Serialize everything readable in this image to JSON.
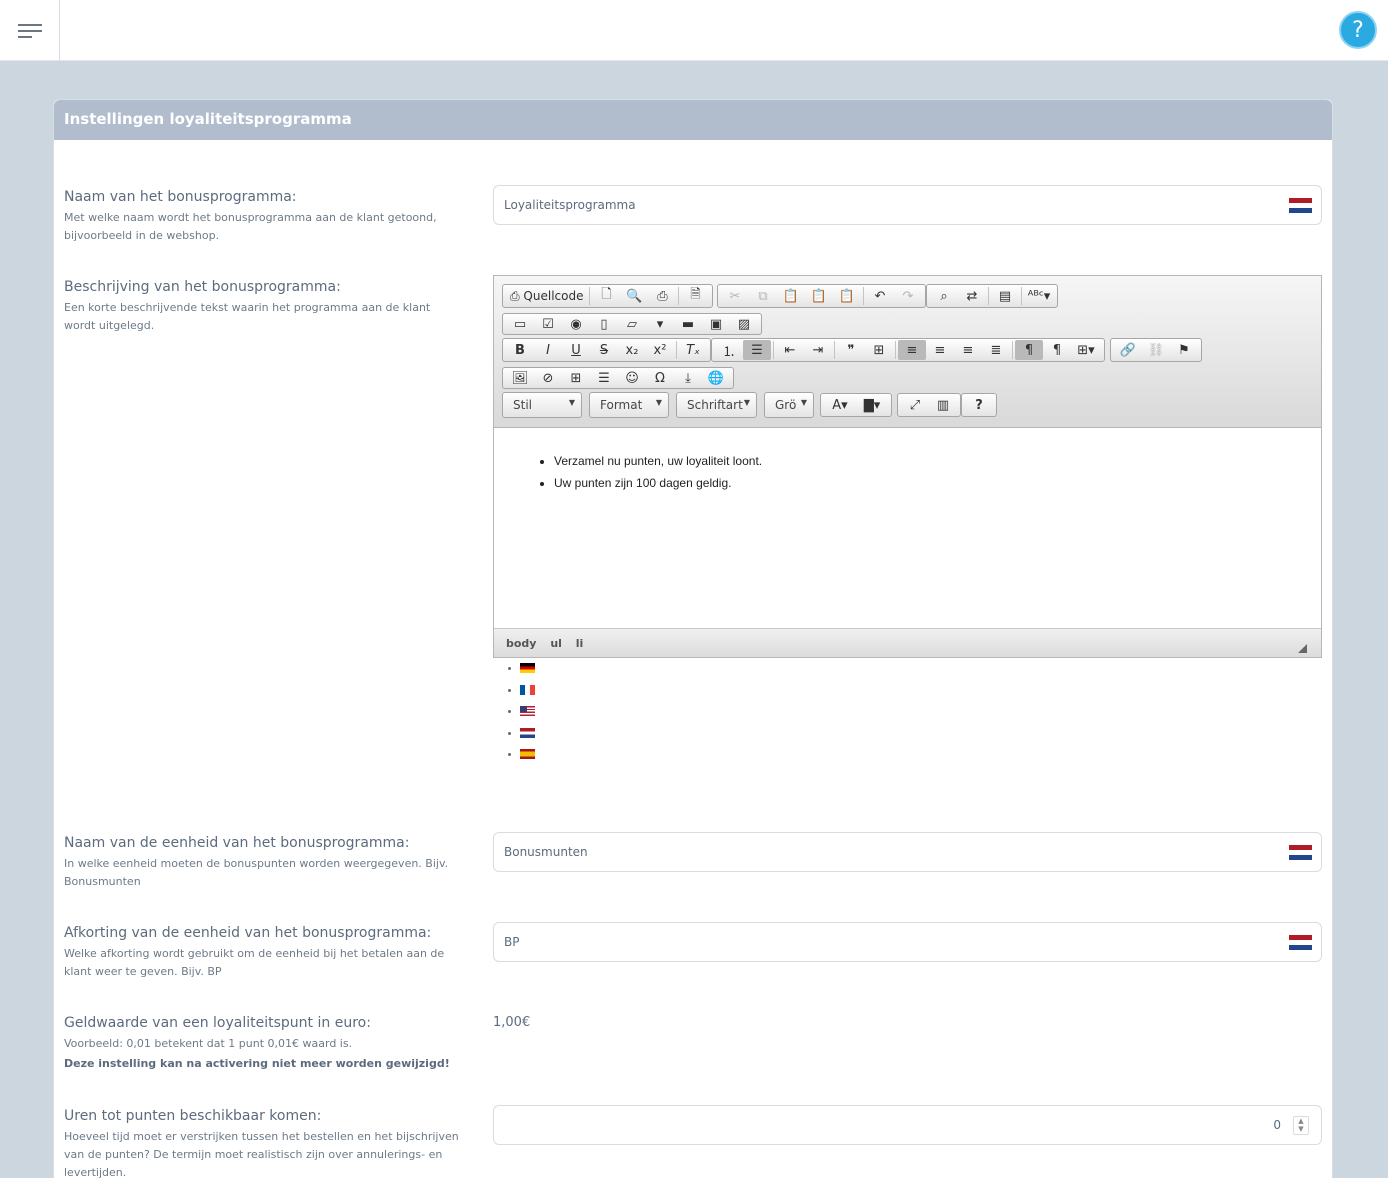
{
  "header": {
    "menu_icon": "hamburger-menu-icon",
    "help_icon": "help-icon",
    "help_glyph": "?"
  },
  "panel": {
    "title": "Instellingen loyaliteitsprogramma"
  },
  "fields": {
    "name": {
      "label": "Naam van het bonusprogramma:",
      "hint": "Met welke naam wordt het bonusprogramma aan de klant getoond, bijvoorbeeld in de webshop.",
      "value": "Loyaliteitsprogramma"
    },
    "description": {
      "label": "Beschrijving van het bonusprogramma:",
      "hint": "Een korte beschrijvende tekst waarin het programma aan de klant wordt uitgelegd."
    },
    "unit": {
      "label": "Naam van de eenheid van het bonusprogramma:",
      "hint": "In welke eenheid moeten de bonuspunten worden weergegeven. Bijv. Bonusmunten",
      "value": "Bonusmunten"
    },
    "abbr": {
      "label": "Afkorting van de eenheid van het bonusprogramma:",
      "hint": "Welke afkorting wordt gebruikt om de eenheid bij het betalen aan de klant weer te geven. Bijv. BP",
      "value": "BP"
    },
    "money": {
      "label": "Geldwaarde van een loyaliteitspunt in euro:",
      "hint": "Voorbeeld: 0,01 betekent dat 1 punt 0,01€ waard is.",
      "warning": "Deze instelling kan na activering niet meer worden gewijzigd!",
      "value": "1,00€"
    },
    "hours": {
      "label": "Uren tot punten beschikbaar komen:",
      "hint": "Hoeveel tijd moet er verstrijken tussen het bestellen en het bijschrijven van de punten? De termijn moet realistisch zijn over annulerings- en levertijden.",
      "value": "0"
    }
  },
  "editor": {
    "source_label": "Quellcode",
    "style_combo": "Stil",
    "format_combo": "Format",
    "font_combo": "Schriftart",
    "size_combo": "Grö",
    "content_items": [
      "Verzamel nu punten, uw loyaliteit loont.",
      "Uw punten zijn 100 dagen geldig."
    ],
    "path": [
      "body",
      "ul",
      "li"
    ]
  },
  "languages": [
    "de",
    "fr",
    "us",
    "nl",
    "es"
  ],
  "colors": {
    "header_bg": "#b1bccd",
    "help": "#2ba9e1",
    "page_bg": "#ccd6de"
  }
}
